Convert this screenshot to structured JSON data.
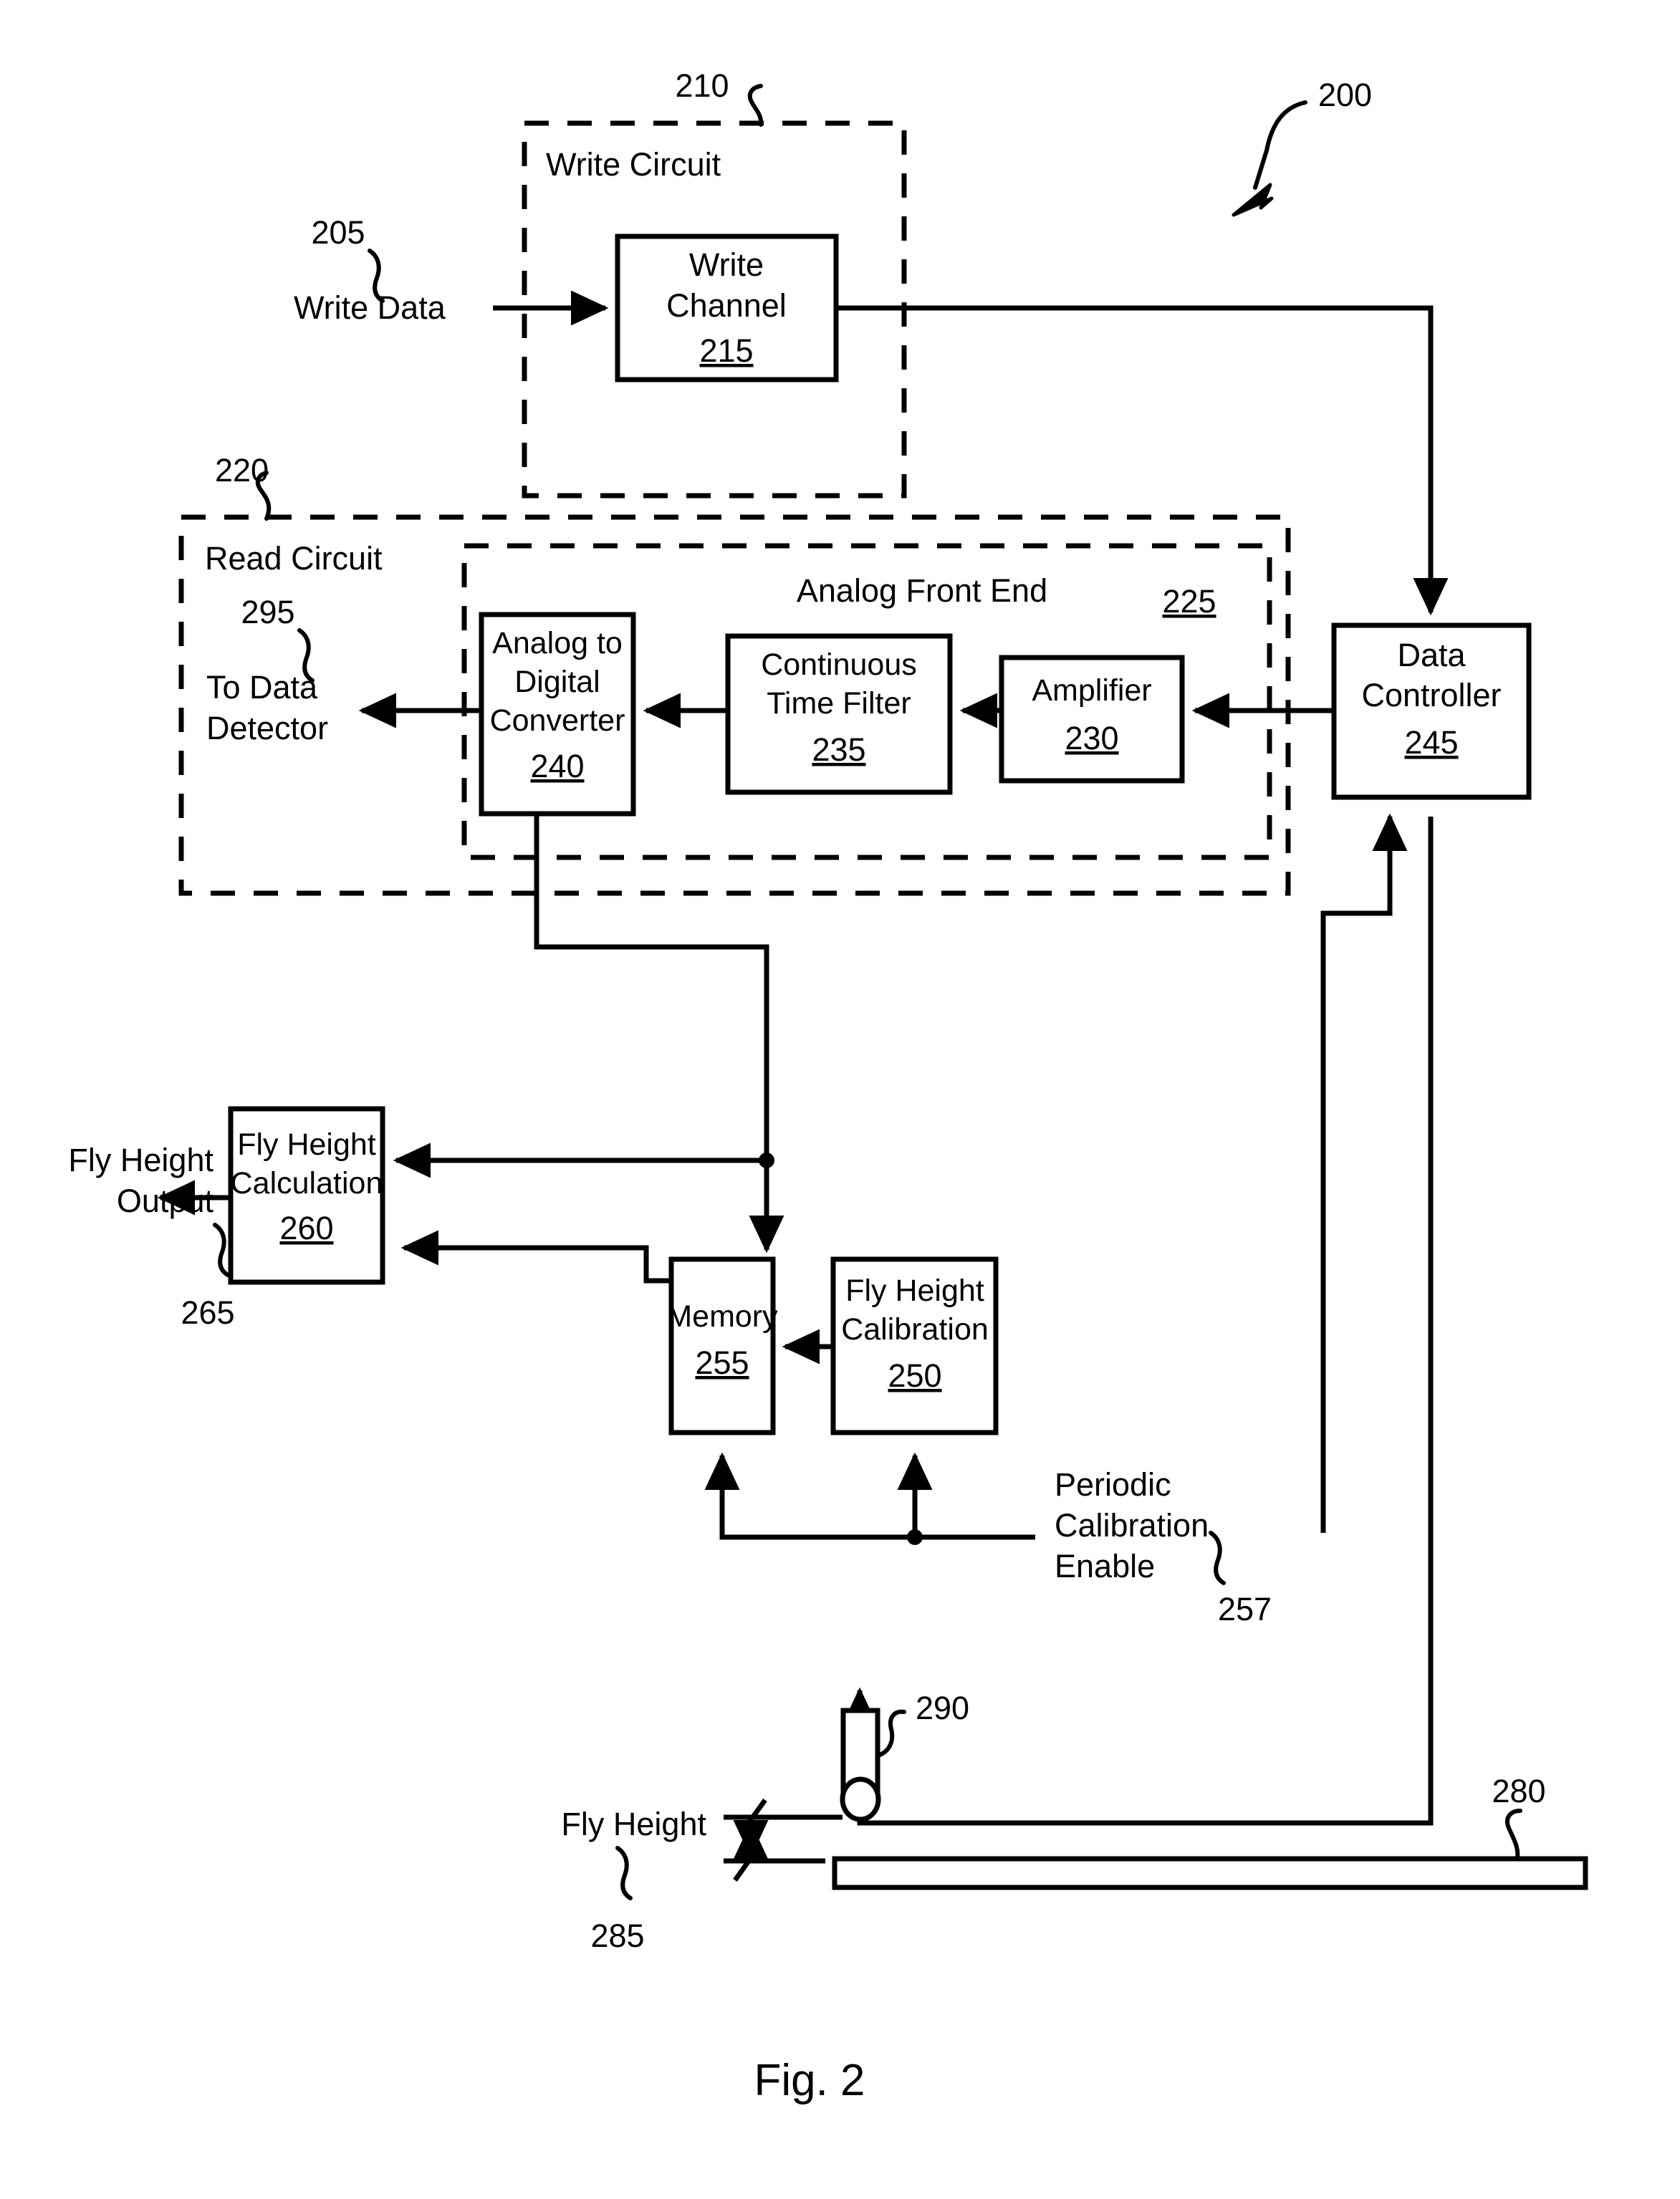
{
  "figure": {
    "caption": "Fig. 2",
    "system_ref": "200"
  },
  "blocks": [
    {
      "id": "write_channel",
      "lines": [
        "Write",
        "Channel"
      ],
      "ref": "215"
    },
    {
      "id": "adc",
      "lines": [
        "Analog to",
        "Digital",
        "Converter"
      ],
      "ref": "240"
    },
    {
      "id": "ctf",
      "lines": [
        "Continuous",
        "Time Filter"
      ],
      "ref": "235"
    },
    {
      "id": "amplifier",
      "lines": [
        "Amplifier"
      ],
      "ref": "230"
    },
    {
      "id": "data_controller",
      "lines": [
        "Data",
        "Controller"
      ],
      "ref": "245"
    },
    {
      "id": "fly_height_calculation",
      "lines": [
        "Fly Height",
        "Calculation"
      ],
      "ref": "260"
    },
    {
      "id": "memory",
      "lines": [
        "Memory"
      ],
      "ref": "255"
    },
    {
      "id": "fly_height_calibration",
      "lines": [
        "Fly Height",
        "Calibration"
      ],
      "ref": "250"
    }
  ],
  "groups": [
    {
      "id": "write_circuit",
      "label": "Write Circuit",
      "ref": "210"
    },
    {
      "id": "read_circuit",
      "label": "Read Circuit",
      "ref": "220"
    },
    {
      "id": "analog_front_end",
      "label": "Analog Front End",
      "ref": "225"
    }
  ],
  "signals": [
    {
      "id": "write_data",
      "lines": [
        "Write Data"
      ],
      "ref": "205"
    },
    {
      "id": "to_data_detector",
      "lines": [
        "To Data",
        "Detector"
      ],
      "ref": "295"
    },
    {
      "id": "fly_height_output",
      "lines": [
        "Fly Height",
        "Output"
      ],
      "ref": "265"
    },
    {
      "id": "periodic_calibration_enable",
      "lines": [
        "Periodic",
        "Calibration",
        "Enable"
      ],
      "ref": "257"
    },
    {
      "id": "fly_height_gap",
      "lines": [
        "Fly Height"
      ],
      "ref": "285"
    }
  ],
  "components": [
    {
      "id": "read_write_head",
      "ref": "290"
    },
    {
      "id": "storage_medium",
      "ref": "280"
    }
  ],
  "text": {
    "write_circuit_label": "Write Circuit",
    "read_circuit_label": "Read Circuit",
    "analog_front_end_label": "Analog Front End",
    "write_channel_l1": "Write",
    "write_channel_l2": "Channel",
    "write_channel_ref": "215",
    "adc_l1": "Analog to",
    "adc_l2": "Digital",
    "adc_l3": "Converter",
    "adc_ref": "240",
    "ctf_l1": "Continuous",
    "ctf_l2": "Time Filter",
    "ctf_ref": "235",
    "amp_l1": "Amplifier",
    "amp_ref": "230",
    "dc_l1": "Data",
    "dc_l2": "Controller",
    "dc_ref": "245",
    "fhcalc_l1": "Fly Height",
    "fhcalc_l2": "Calculation",
    "fhcalc_ref": "260",
    "mem_l1": "Memory",
    "mem_ref": "255",
    "fhcal_l1": "Fly Height",
    "fhcal_l2": "Calibration",
    "fhcal_ref": "250",
    "write_data": "Write Data",
    "write_data_ref": "205",
    "write_circuit_ref": "210",
    "read_circuit_ref": "220",
    "afe_ref": "225",
    "to_data_l1": "To Data",
    "to_data_l2": "Detector",
    "to_data_ref": "295",
    "fho_l1": "Fly Height",
    "fho_l2": "Output",
    "fho_ref": "265",
    "pce_l1": "Periodic",
    "pce_l2": "Calibration",
    "pce_l3": "Enable",
    "pce_ref": "257",
    "head_ref": "290",
    "medium_ref": "280",
    "flyheight_gap_label": "Fly Height",
    "flyheight_gap_ref": "285",
    "system_ref": "200",
    "figure_caption": "Fig. 2"
  }
}
